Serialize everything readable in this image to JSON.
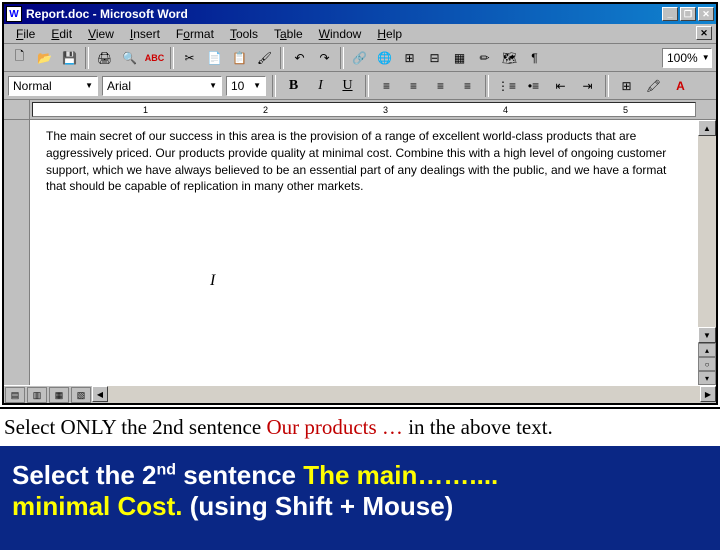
{
  "titlebar": {
    "icon": "W",
    "title": "Report.doc - Microsoft Word"
  },
  "menu": {
    "file": "File",
    "edit": "Edit",
    "view": "View",
    "insert": "Insert",
    "format": "Format",
    "tools": "Tools",
    "table": "Table",
    "window": "Window",
    "help": "Help"
  },
  "toolbar": {
    "new": "🗋",
    "open": "📂",
    "save": "💾",
    "print": "🖨",
    "preview": "🔍",
    "spell": "✓",
    "cut": "✂",
    "copy": "📄",
    "paste": "📋",
    "fmtpaint": "🖌",
    "undo": "↶",
    "redo": "↷",
    "link": "🔗",
    "web": "🌐",
    "tables": "⊞",
    "excel": "⊟",
    "cols": "▦",
    "draw": "✏",
    "map": "🗺",
    "para": "¶",
    "zoom": "100%"
  },
  "format": {
    "style": "Normal",
    "font": "Arial",
    "size": "10",
    "bold": "B",
    "italic": "I",
    "underline": "U"
  },
  "ruler": {
    "n1": "1",
    "n2": "2",
    "n3": "3",
    "n4": "4",
    "n5": "5"
  },
  "document": {
    "text": "The main secret of our success in this area is the provision of a range of excellent world-class products that are aggressively priced. Our products provide quality at minimal cost.  Combine this with a high level of ongoing customer support, which we have always believed to be an essential part of any dealings with the public, and we have a format that should be capable of replication in many other markets.",
    "cursor": "I"
  },
  "instruction1": {
    "a": "Select ONLY the 2nd sentence ",
    "b": "Our products …",
    "c": " in the above text."
  },
  "instruction2": {
    "a": "Select the 2",
    "sup": "nd",
    "b": " sentence  ",
    "c": "The main……....",
    "d": "minimal Cost.",
    "e": " (using Shift + Mouse)"
  }
}
